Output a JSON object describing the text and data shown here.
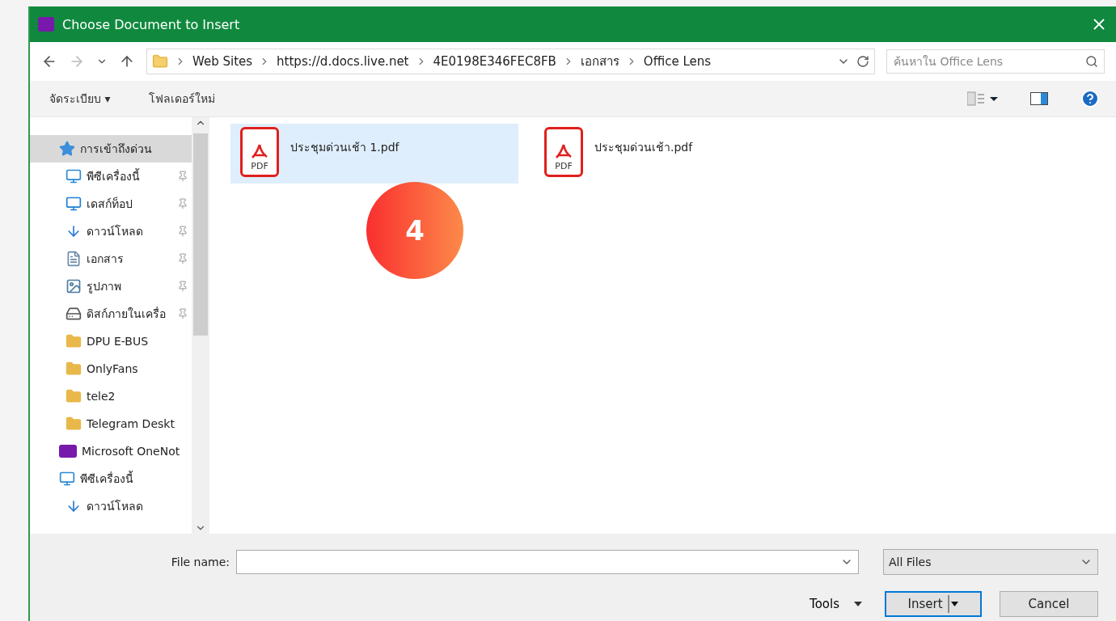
{
  "window": {
    "title": "Choose Document to Insert"
  },
  "address": {
    "crumbs": [
      "Web Sites",
      "https://d.docs.live.net",
      "4E0198E346FEC8FB",
      "เอกสาร",
      "Office Lens"
    ]
  },
  "search": {
    "placeholder": "ค้นหาใน Office Lens"
  },
  "toolbar": {
    "organize": "จัดระเบียบ ▾",
    "new_folder": "โฟลเดอร์ใหม่"
  },
  "sidebar": {
    "items": [
      {
        "label": "การเข้าถึงด่วน",
        "kind": "star",
        "selected": true,
        "children": [
          {
            "label": "พีซีเครื่องนี้",
            "kind": "monitor",
            "pinned": true,
            "selected": false
          },
          {
            "label": "เดสก์ท็อป",
            "kind": "desktop",
            "pinned": true,
            "selected": false
          },
          {
            "label": "ดาวน์โหลด",
            "kind": "download",
            "pinned": true,
            "selected": false
          },
          {
            "label": "เอกสาร",
            "kind": "document",
            "pinned": true,
            "selected": false
          },
          {
            "label": "รูปภาพ",
            "kind": "picture",
            "pinned": true,
            "selected": false
          },
          {
            "label": "ดิสก์ภายในเครื่อ",
            "kind": "drive",
            "pinned": true,
            "selected": false
          },
          {
            "label": "DPU E-BUS",
            "kind": "folder",
            "pinned": false,
            "selected": false
          },
          {
            "label": "OnlyFans",
            "kind": "folder",
            "pinned": false,
            "selected": false
          },
          {
            "label": "tele2",
            "kind": "folder",
            "pinned": false,
            "selected": false
          },
          {
            "label": "Telegram Deskt",
            "kind": "folder",
            "pinned": false,
            "selected": false
          }
        ]
      },
      {
        "label": "Microsoft OneNot",
        "kind": "onenote",
        "selected": false
      },
      {
        "label": "พีซีเครื่องนี้",
        "kind": "monitor",
        "selected": false,
        "children": [
          {
            "label": "ดาวน์โหลด",
            "kind": "download",
            "pinned": false,
            "selected": false
          }
        ]
      }
    ]
  },
  "files": [
    {
      "name": "ประชุมด่วนเช้า 1.pdf",
      "type_label": "PDF",
      "selected": true
    },
    {
      "name": "ประชุมด่วนเช้า.pdf",
      "type_label": "PDF",
      "selected": false
    }
  ],
  "step_badge": "4",
  "footer": {
    "file_name_label": "File name:",
    "file_type": "All Files",
    "tools": "Tools",
    "insert": "Insert",
    "cancel": "Cancel"
  }
}
